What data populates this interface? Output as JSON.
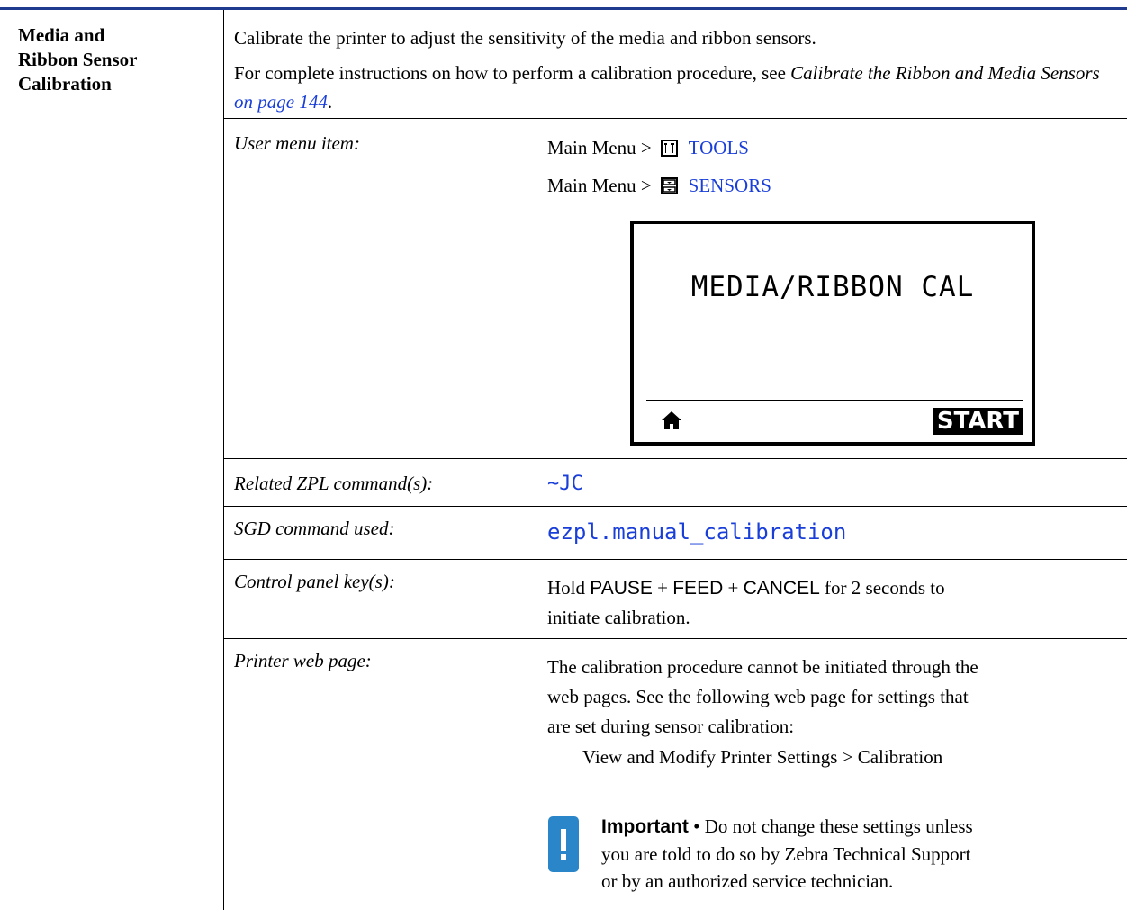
{
  "section": {
    "title_line1": "Media and",
    "title_line2": "Ribbon Sensor",
    "title_line3": "Calibration",
    "intro": "Calibrate the printer to adjust the sensitivity of the media and ribbon sensors.",
    "instructions_prefix": "For complete instructions on how to perform a calibration procedure, see ",
    "instructions_ref": "Calibrate the Ribbon and Media Sensors",
    "instructions_link": "on page 144",
    "instructions_suffix": "."
  },
  "user_menu": {
    "label": "User menu item:",
    "path1_prefix": "Main Menu >",
    "path1_icon": "tools-icon",
    "path1_link": "TOOLS",
    "path2_prefix": "Main Menu >",
    "path2_icon": "sensors-icon",
    "path2_link": "SENSORS"
  },
  "lcd": {
    "title": "MEDIA/RIBBON CAL",
    "home_icon": "home-icon",
    "start_label": "START"
  },
  "zpl": {
    "label": "Related ZPL command(s):",
    "value": "~JC"
  },
  "sgd": {
    "label": "SGD command used:",
    "value": "ezpl.manual_calibration"
  },
  "control_panel": {
    "label": "Control panel key(s):",
    "hold": "Hold ",
    "key1": "PAUSE",
    "plus1": " + ",
    "key2": "FEED",
    "plus2": " + ",
    "key3": "CANCEL",
    "suffix_line1": " for 2 seconds to",
    "line2": "initiate calibration."
  },
  "web_page": {
    "label": "Printer web page:",
    "text_line1": "The calibration procedure cannot be initiated through the",
    "text_line2": "web pages. See the following web page for settings that",
    "text_line3": "are set during sensor calibration:",
    "path": "View and Modify Printer Settings > Calibration",
    "important_icon": "exclamation-icon",
    "important_label": "Important",
    "bullet": " • ",
    "important_line1": "Do not change these settings unless",
    "important_line2": "you are told to do so by Zebra Technical Support",
    "important_line3": "or by an authorized service technician."
  }
}
